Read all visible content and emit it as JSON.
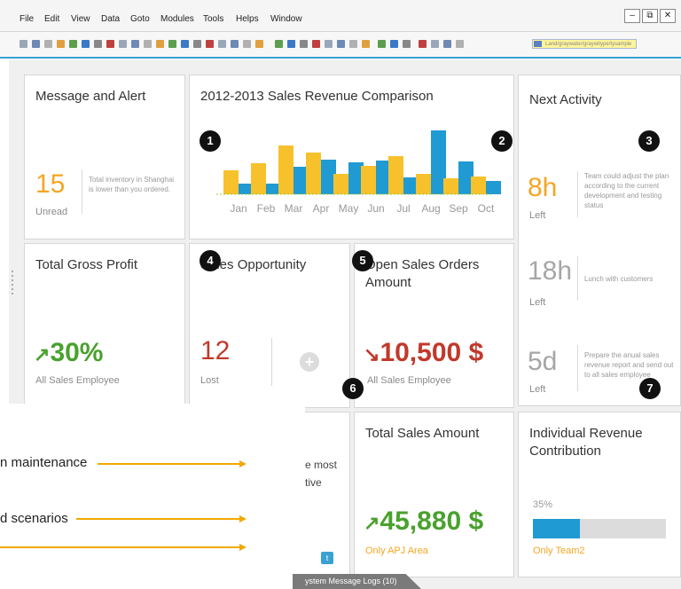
{
  "menu": [
    "File",
    "Edit",
    "View",
    "Data",
    "Goto",
    "Modules",
    "Tools",
    "Helps",
    "Window"
  ],
  "window_controls": [
    "–",
    "⧉",
    "✕"
  ],
  "search_placeholder": "Land/graywater/graywitype/tysample",
  "tiles": {
    "message": {
      "title": "Message and Alert",
      "value": "15",
      "caption": "Unread",
      "note": "Total inventory in Shanghai is lower than you ordered."
    },
    "sales_chart": {
      "title": "2012-2013 Sales Revenue Comparison"
    },
    "next_activity": {
      "title": "Next Activity",
      "items": [
        {
          "value": "8h",
          "caption": "Left",
          "note": "Team could adjust the plan according to the current development and testing status"
        },
        {
          "value": "18h",
          "caption": "Left",
          "note": "Lunch with customers"
        },
        {
          "value": "5d",
          "caption": "Left",
          "note": "Prepare the anual sales revenue report and send out to all sales employee"
        }
      ]
    },
    "gross_profit": {
      "title": "Total Gross Profit",
      "value": "30%",
      "caption": "All Sales Employee"
    },
    "opportunity": {
      "title": "Sales Opportunity",
      "value": "12",
      "caption": "Lost",
      "add_label": "+"
    },
    "open_orders": {
      "title": "Open Sales Orders Amount",
      "value": "10,500 $",
      "caption": "All Sales Employee"
    },
    "partial_tile": {
      "line1": "e most",
      "line2": "tive"
    },
    "sales_amount": {
      "title": "Total Sales Amount",
      "value": "45,880 $",
      "caption": "Only APJ Area"
    },
    "individual": {
      "title": "Individual Revenue Contribution",
      "percent_label": "35%",
      "progress": 0.35,
      "caption": "Only Team2"
    }
  },
  "markers": [
    "1",
    "2",
    "3",
    "4",
    "5",
    "6",
    "7"
  ],
  "overlay": {
    "line1": "n maintenance",
    "line2": "d scenarios"
  },
  "taskbar_label": "ystem Message Logs (10)",
  "colors": {
    "orange": "#f5a623",
    "green": "#4aa12e",
    "red": "#c0392b",
    "blue": "#1f9ad2",
    "yellow": "#f7c12c",
    "gray": "#a6a6a6"
  },
  "chart_data": {
    "type": "bar",
    "categories": [
      "Jan",
      "Feb",
      "Mar",
      "Apr",
      "May",
      "Jun",
      "Jul",
      "Aug",
      "Sep",
      "Oct"
    ],
    "series": [
      {
        "values": [
          27,
          35,
          55,
          47,
          23,
          32,
          43,
          23,
          18,
          20
        ]
      },
      {
        "values": [
          12,
          12,
          31,
          39,
          36,
          38,
          19,
          72,
          37,
          15
        ]
      }
    ],
    "ylim": [
      0,
      80
    ],
    "title": "2012-2013 Sales Revenue Comparison"
  }
}
